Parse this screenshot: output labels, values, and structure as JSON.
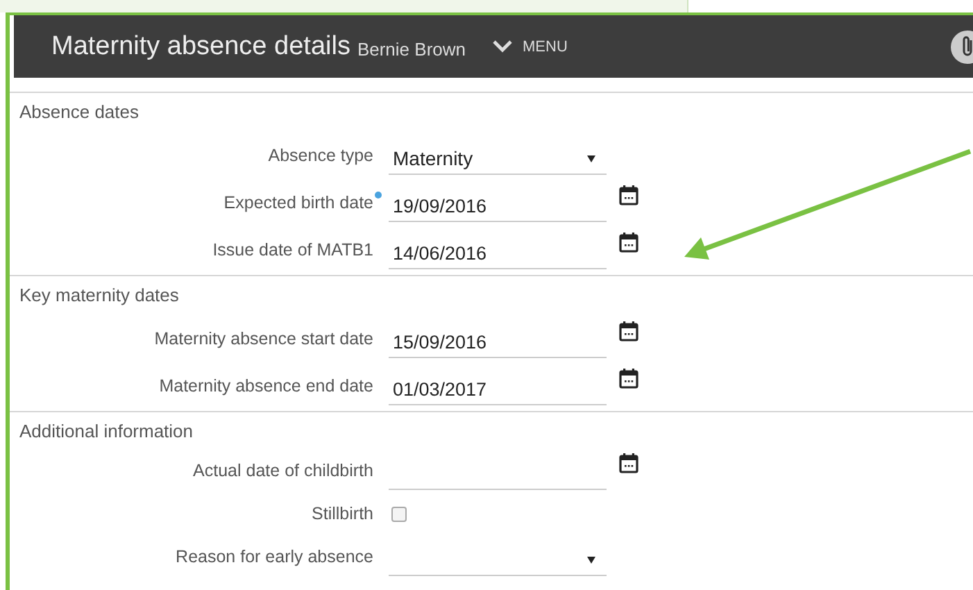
{
  "header": {
    "title": "Maternity absence details",
    "employee": "Bernie Brown",
    "menu": "MENU"
  },
  "sections": [
    {
      "heading": "Absence dates",
      "fields": [
        {
          "kind": "select",
          "label": "Absence type",
          "value": "Maternity",
          "required": false
        },
        {
          "kind": "date",
          "label": "Expected birth date",
          "value": "19/09/2016",
          "required": true
        },
        {
          "kind": "date",
          "label": "Issue date of MATB1",
          "value": "14/06/2016",
          "required": false
        }
      ]
    },
    {
      "heading": "Key maternity dates",
      "fields": [
        {
          "kind": "date",
          "label": "Maternity absence start date",
          "value": "15/09/2016",
          "required": false
        },
        {
          "kind": "date",
          "label": "Maternity absence end date",
          "value": "01/03/2017",
          "required": false
        }
      ]
    },
    {
      "heading": "Additional information",
      "fields": [
        {
          "kind": "date",
          "label": "Actual date of childbirth",
          "required": false
        },
        {
          "kind": "checkbox",
          "label": "Stillbirth",
          "checked": false,
          "required": false
        },
        {
          "kind": "select",
          "label": "Reason for early absence",
          "required": false
        }
      ]
    }
  ]
}
